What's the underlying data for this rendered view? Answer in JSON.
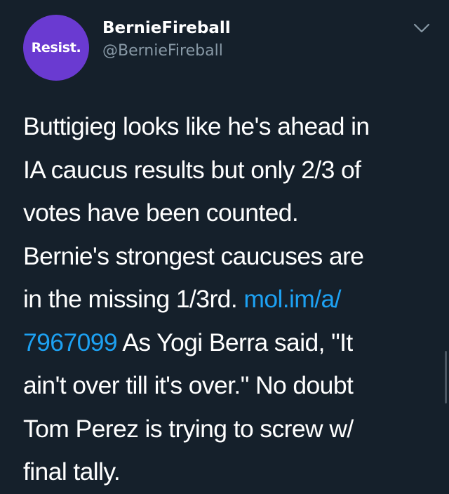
{
  "author": {
    "avatar_text": "Resist.",
    "avatar_color": "#6a3ad1",
    "display_name": "BernieFireball",
    "handle": "@BernieFireball"
  },
  "menu_icon": "chevron-down-icon",
  "tweet": {
    "lines": [
      {
        "text": "Buttigieg looks like he's ahead in"
      },
      {
        "text": "IA caucus results but only 2/3 of"
      },
      {
        "text": "votes have been counted."
      },
      {
        "text": "Bernie's strongest caucuses are"
      },
      {
        "pre": "in the missing 1/3rd. ",
        "link": "mol.im/a/"
      },
      {
        "link": "7967099",
        "post": " As Yogi Berra said, \"It"
      },
      {
        "text": "ain't over till it's over.\"  No doubt"
      },
      {
        "text": "Tom Perez is trying to screw w/"
      },
      {
        "text": "final tally."
      }
    ]
  },
  "colors": {
    "background": "#15202b",
    "text": "#ffffff",
    "secondary": "#8899a6",
    "link": "#1da1f2"
  }
}
